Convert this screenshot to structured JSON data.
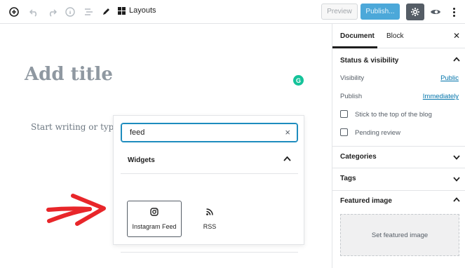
{
  "toolbar": {
    "layouts_label": "Layouts",
    "preview_label": "Preview",
    "publish_label": "Publish...",
    "icons": [
      "add-block-icon",
      "undo-icon",
      "redo-icon",
      "info-icon",
      "list-view-icon",
      "edit-icon",
      "layouts-icon",
      "settings-icon",
      "eye-icon",
      "more-options-icon"
    ]
  },
  "editor": {
    "title_placeholder": "Add title",
    "body_placeholder": "Start writing or type / to choose a block",
    "grammarly_letter": "G"
  },
  "inserter": {
    "search_value": "feed",
    "panel_title": "Widgets",
    "blocks": [
      {
        "label": "Instagram Feed",
        "icon": "instagram-icon",
        "selected": true
      },
      {
        "label": "RSS",
        "icon": "rss-icon",
        "selected": false
      }
    ]
  },
  "sidebar": {
    "tabs": [
      "Document",
      "Block"
    ],
    "status_heading": "Status & visibility",
    "visibility_label": "Visibility",
    "visibility_value": "Public",
    "publish_label": "Publish",
    "publish_value": "Immediately",
    "sticky_label": "Stick to the top of the blog",
    "pending_label": "Pending review",
    "categories_heading": "Categories",
    "tags_heading": "Tags",
    "featured_heading": "Featured image",
    "featured_button": "Set featured image"
  },
  "colors": {
    "accent": "#1e8cbe",
    "publish_bg": "#4ca8d9",
    "arrow": "#e8262a",
    "grammarly": "#15c39a",
    "link": "#0073aa"
  }
}
